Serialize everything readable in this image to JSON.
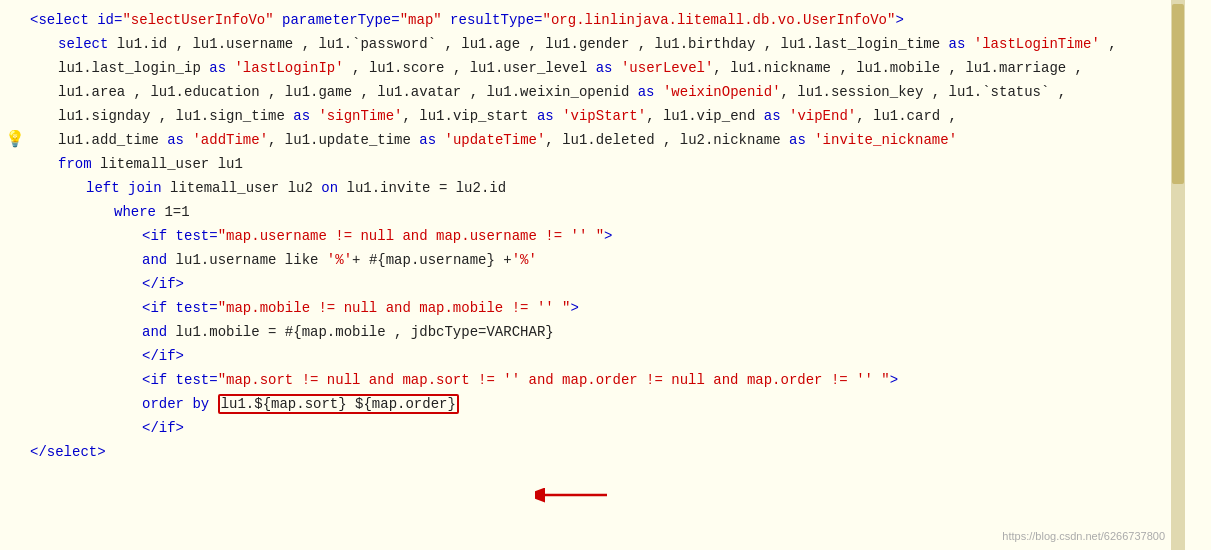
{
  "code": {
    "lines": [
      {
        "id": 1,
        "indent": 0,
        "has_bulb": false,
        "content_parts": [
          {
            "text": "<select id=",
            "color": "blue"
          },
          {
            "text": "\"selectUserInfoVo\"",
            "color": "red"
          },
          {
            "text": " parameterType=",
            "color": "blue"
          },
          {
            "text": "\"map\"",
            "color": "red"
          },
          {
            "text": " resultType=",
            "color": "blue"
          },
          {
            "text": "\"org.linlinjava.litemall.db.vo.UserInfoVo\"",
            "color": "red"
          },
          {
            "text": ">",
            "color": "blue"
          }
        ]
      },
      {
        "id": 2,
        "indent": 1,
        "has_bulb": false,
        "content_parts": [
          {
            "text": "select",
            "color": "keyword"
          },
          {
            "text": " lu1.id , lu1.username , lu1.",
            "color": "black"
          },
          {
            "text": "`password`",
            "color": "black"
          },
          {
            "text": " , lu1.age , lu1.gender , lu1.birthday , lu1.last_login_time ",
            "color": "black"
          },
          {
            "text": "as",
            "color": "keyword"
          },
          {
            "text": " ",
            "color": "black"
          },
          {
            "text": "'lastLoginTime'",
            "color": "red"
          },
          {
            "text": " ,",
            "color": "black"
          }
        ]
      },
      {
        "id": 3,
        "indent": 1,
        "has_bulb": false,
        "content_parts": [
          {
            "text": "lu1.last_login_ip ",
            "color": "black"
          },
          {
            "text": "as",
            "color": "keyword"
          },
          {
            "text": " ",
            "color": "black"
          },
          {
            "text": "'lastLoginIp'",
            "color": "red"
          },
          {
            "text": " , lu1.score , lu1.user_level ",
            "color": "black"
          },
          {
            "text": "as",
            "color": "keyword"
          },
          {
            "text": " ",
            "color": "black"
          },
          {
            "text": "'userLevel'",
            "color": "red"
          },
          {
            "text": ", lu1.nickname , lu1.mobile , lu1.marriage ,",
            "color": "black"
          }
        ]
      },
      {
        "id": 4,
        "indent": 1,
        "has_bulb": false,
        "content_parts": [
          {
            "text": "lu1.area , lu1.education , lu1.game , lu1.avatar , lu1.weixin_openid ",
            "color": "black"
          },
          {
            "text": "as",
            "color": "keyword"
          },
          {
            "text": " ",
            "color": "black"
          },
          {
            "text": "'weixinOpenid'",
            "color": "red"
          },
          {
            "text": ", lu1.session_key , lu1.",
            "color": "black"
          },
          {
            "text": "`status`",
            "color": "black"
          },
          {
            "text": " ,",
            "color": "black"
          }
        ]
      },
      {
        "id": 5,
        "indent": 1,
        "has_bulb": false,
        "content_parts": [
          {
            "text": "lu1.signday , lu1.sign_time ",
            "color": "black"
          },
          {
            "text": "as",
            "color": "keyword"
          },
          {
            "text": " ",
            "color": "black"
          },
          {
            "text": "'signTime'",
            "color": "red"
          },
          {
            "text": ", lu1.vip_start ",
            "color": "black"
          },
          {
            "text": "as",
            "color": "keyword"
          },
          {
            "text": " ",
            "color": "black"
          },
          {
            "text": "'vipStart'",
            "color": "red"
          },
          {
            "text": ", lu1.vip_end ",
            "color": "black"
          },
          {
            "text": "as",
            "color": "keyword"
          },
          {
            "text": " ",
            "color": "black"
          },
          {
            "text": "'vipEnd'",
            "color": "red"
          },
          {
            "text": ", lu1.card ,",
            "color": "black"
          }
        ]
      },
      {
        "id": 6,
        "indent": 1,
        "has_bulb": true,
        "content_parts": [
          {
            "text": "lu1.add_time ",
            "color": "black"
          },
          {
            "text": "as",
            "color": "keyword"
          },
          {
            "text": " ",
            "color": "black"
          },
          {
            "text": "'addTime'",
            "color": "red"
          },
          {
            "text": ", lu1.update_time ",
            "color": "black"
          },
          {
            "text": "as",
            "color": "keyword"
          },
          {
            "text": " ",
            "color": "black"
          },
          {
            "text": "'updateTime'",
            "color": "red"
          },
          {
            "text": ", lu1.deleted , lu2.nickname ",
            "color": "black"
          },
          {
            "text": "as",
            "color": "keyword"
          },
          {
            "text": " ",
            "color": "black"
          },
          {
            "text": "'invite_nickname'",
            "color": "red"
          }
        ]
      },
      {
        "id": 7,
        "indent": 1,
        "has_bulb": false,
        "content_parts": [
          {
            "text": "from",
            "color": "keyword"
          },
          {
            "text": " litemall_user lu1",
            "color": "black"
          }
        ]
      },
      {
        "id": 8,
        "indent": 2,
        "has_bulb": false,
        "content_parts": [
          {
            "text": "left join",
            "color": "keyword"
          },
          {
            "text": " litemall_user lu2 ",
            "color": "black"
          },
          {
            "text": "on",
            "color": "keyword"
          },
          {
            "text": " lu1.invite = lu2.id",
            "color": "black"
          }
        ]
      },
      {
        "id": 9,
        "indent": 3,
        "has_bulb": false,
        "content_parts": [
          {
            "text": "where",
            "color": "keyword"
          },
          {
            "text": " 1=1",
            "color": "black"
          }
        ]
      },
      {
        "id": 10,
        "indent": 4,
        "has_bulb": false,
        "content_parts": [
          {
            "text": "<if test=",
            "color": "blue"
          },
          {
            "text": "\"map.username != null and map.username != '' \"",
            "color": "red"
          },
          {
            "text": ">",
            "color": "blue"
          }
        ]
      },
      {
        "id": 11,
        "indent": 4,
        "has_bulb": false,
        "content_parts": [
          {
            "text": "and",
            "color": "keyword"
          },
          {
            "text": " lu1.username like ",
            "color": "black"
          },
          {
            "text": "'%'",
            "color": "red"
          },
          {
            "text": "+ #{map.username} +",
            "color": "black"
          },
          {
            "text": "'%'",
            "color": "red"
          }
        ]
      },
      {
        "id": 12,
        "indent": 4,
        "has_bulb": false,
        "content_parts": [
          {
            "text": "</if>",
            "color": "blue"
          }
        ]
      },
      {
        "id": 13,
        "indent": 4,
        "has_bulb": false,
        "content_parts": [
          {
            "text": "<if test=",
            "color": "blue"
          },
          {
            "text": "\"map.mobile != null and map.mobile != '' \"",
            "color": "red"
          },
          {
            "text": ">",
            "color": "blue"
          }
        ]
      },
      {
        "id": 14,
        "indent": 4,
        "has_bulb": false,
        "content_parts": [
          {
            "text": "and",
            "color": "keyword"
          },
          {
            "text": " lu1.mobile = #{map.mobile , jdbcType=VARCHAR}",
            "color": "black"
          }
        ]
      },
      {
        "id": 15,
        "indent": 4,
        "has_bulb": false,
        "content_parts": [
          {
            "text": "</if>",
            "color": "blue"
          }
        ]
      },
      {
        "id": 16,
        "indent": 4,
        "has_bulb": false,
        "content_parts": [
          {
            "text": "<if test=",
            "color": "blue"
          },
          {
            "text": "\"map.sort != null and map.sort != '' and map.order != null and map.order != '' \"",
            "color": "red"
          },
          {
            "text": ">",
            "color": "blue"
          }
        ]
      },
      {
        "id": 17,
        "indent": 4,
        "has_bulb": false,
        "content_parts": [
          {
            "text": "order by ",
            "color": "keyword"
          },
          {
            "text": "lu1.${map.sort} ${map.order}",
            "color": "black",
            "highlight": true
          }
        ]
      },
      {
        "id": 18,
        "indent": 4,
        "has_bulb": false,
        "content_parts": [
          {
            "text": "</if>",
            "color": "blue"
          }
        ]
      },
      {
        "id": 19,
        "indent": 0,
        "has_bulb": false,
        "content_parts": [
          {
            "text": "</select>",
            "color": "blue"
          }
        ]
      }
    ]
  },
  "watermark": "https://blog.csdn.net/6266737800",
  "icons": {
    "bulb": "💡"
  }
}
